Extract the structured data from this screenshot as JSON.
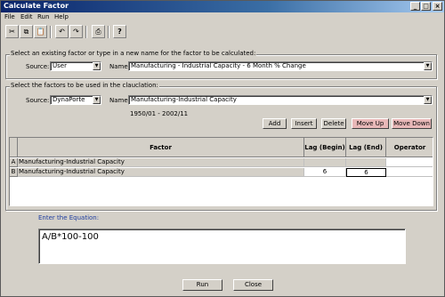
{
  "window": {
    "title": "Calculate Factor",
    "controls": {
      "minimize": "_",
      "maximize": "□",
      "close": "×"
    }
  },
  "menu": [
    "File",
    "Edit",
    "Run",
    "Help"
  ],
  "toolbar": {
    "cut": "✂",
    "copy": "⧉",
    "paste": "📋",
    "undo": "↶",
    "redo": "↷",
    "print": "⎙",
    "help": "?"
  },
  "target": {
    "group_label": "Select an existing factor or type in a new name for the factor to be calculated:",
    "source_label": "Source:",
    "source_value": "User",
    "name_label": "Name:",
    "name_value": "Manufacturing - Industrial Capacity - 6 Month % Change"
  },
  "inputs": {
    "group_label": "Select the factors to be used in the clauclation:",
    "source_label": "Source:",
    "source_value": "DynaPorte",
    "name_label": "Name:",
    "name_value": "Manufacturing-Industrial Capacity",
    "date_range": "1950/01 - 2002/11",
    "buttons": {
      "add": "Add",
      "insert": "Insert",
      "delete": "Delete",
      "move_up": "Move Up",
      "move_down": "Move Down"
    }
  },
  "grid": {
    "columns": {
      "factor": "Factor",
      "lag_begin": "Lag (Begin)",
      "lag_end": "Lag (End)",
      "operator": "Operator"
    },
    "rows": [
      {
        "id": "A",
        "factor": "Manufacturing-Industrial Capacity",
        "lag_begin": "",
        "lag_end": "",
        "operator": ""
      },
      {
        "id": "B",
        "factor": "Manufacturing-Industrial Capacity",
        "lag_begin": "6",
        "lag_end": "6",
        "operator": ""
      }
    ]
  },
  "equation": {
    "label": "Enter the Equation:",
    "value": "A/B*100-100"
  },
  "footer": {
    "run": "Run",
    "close": "Close"
  }
}
